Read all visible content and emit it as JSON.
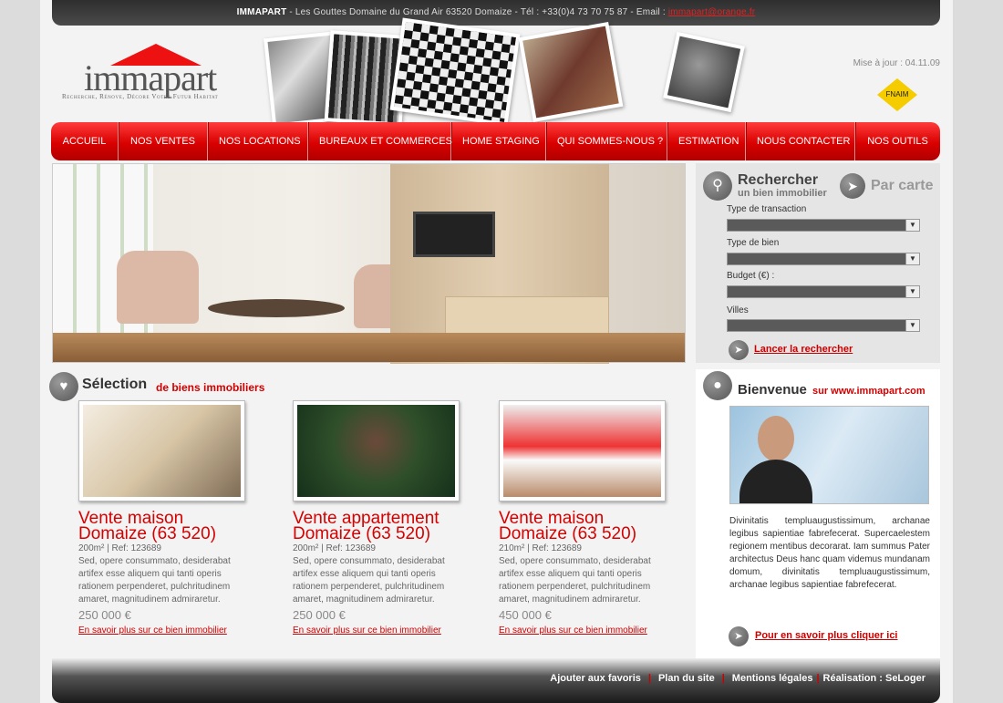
{
  "topbar": {
    "brand": "IMMAPART",
    "address": " - Les Gouttes Domaine du Grand Air 63520 Domaize - Tél : +33(0)4 73 70 75 87 - Email : ",
    "email": "immapart@orange.fr"
  },
  "logo": {
    "word": "immapart",
    "tagline": "Recherche, Rénove, Décore Votre Futur Habitat"
  },
  "update": "Mise à jour : 04.11.09",
  "badge": "FNAIM",
  "nav": [
    "ACCUEIL",
    "NOS VENTES",
    "NOS LOCATIONS",
    "BUREAUX ET COMMERCES",
    "HOME STAGING",
    "QUI SOMMES-NOUS ?",
    "ESTIMATION",
    "NOUS CONTACTER",
    "NOS OUTILS"
  ],
  "search": {
    "title": "Rechercher",
    "subtitle": "un bien immobilier",
    "map": "Par carte",
    "fields": [
      "Type de transaction",
      "Type de bien",
      "Budget (€) :",
      "Villes"
    ],
    "submit": "Lancer la rechercher"
  },
  "selection": {
    "title": "Sélection",
    "subtitle": "de biens immobiliers"
  },
  "listings": [
    {
      "title1": "Vente maison",
      "title2": "Domaize (63 520)",
      "ref": "200m² | Ref: 123689",
      "desc": "Sed, opere consummato, desiderabat artifex esse aliquem qui tanti operis rationem perpenderet, pulchritudinem amaret, magnitudinem admiraretur.",
      "price": "250 000 €",
      "more": "En savoir plus sur ce bien immobilier"
    },
    {
      "title1": "Vente appartement",
      "title2": "Domaize (63 520)",
      "ref": "200m² | Ref: 123689",
      "desc": "Sed, opere consummato, desiderabat artifex esse aliquem qui tanti operis rationem perpenderet, pulchritudinem amaret, magnitudinem admiraretur.",
      "price": "250 000 €",
      "more": "En savoir plus sur ce bien immobilier"
    },
    {
      "title1": "Vente maison",
      "title2": "Domaize (63 520)",
      "ref": "210m² | Ref: 123689",
      "desc": "Sed, opere consummato, desiderabat artifex esse aliquem qui tanti operis rationem perpenderet, pulchritudinem amaret, magnitudinem admiraretur.",
      "price": "450 000 €",
      "more": "En savoir plus sur ce bien immobilier"
    }
  ],
  "welcome": {
    "title": "Bienvenue",
    "site": "sur www.immapart.com",
    "text": "Divinitatis templuaugustissimum, archanae legibus sapientiae fabrefecerat. Supercaelestem regionem mentibus decorarat. Iam summus Pater architectus Deus hanc quam videmus mundanam domum, divinitatis templuaugustissimum, archanae legibus sapientiae fabrefecerat.",
    "more": "Pour en savoir plus cliquer ici"
  },
  "footer": [
    "Ajouter aux favoris",
    "Plan du site",
    "Mentions légales",
    "Réalisation : SeLoger"
  ]
}
